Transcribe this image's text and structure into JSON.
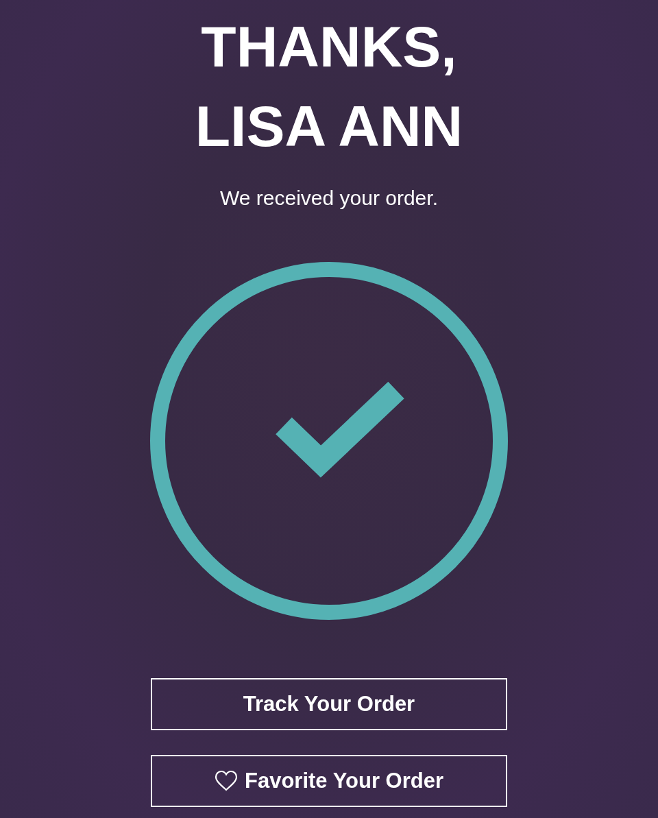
{
  "heading": {
    "lines": [
      "THANKS,",
      "LISA ANN"
    ]
  },
  "message": "We received your order.",
  "buttons": [
    {
      "label": "Track Your Order",
      "kind": "plain"
    },
    {
      "label": "Favorite Your Order",
      "kind": "favorite"
    }
  ]
}
